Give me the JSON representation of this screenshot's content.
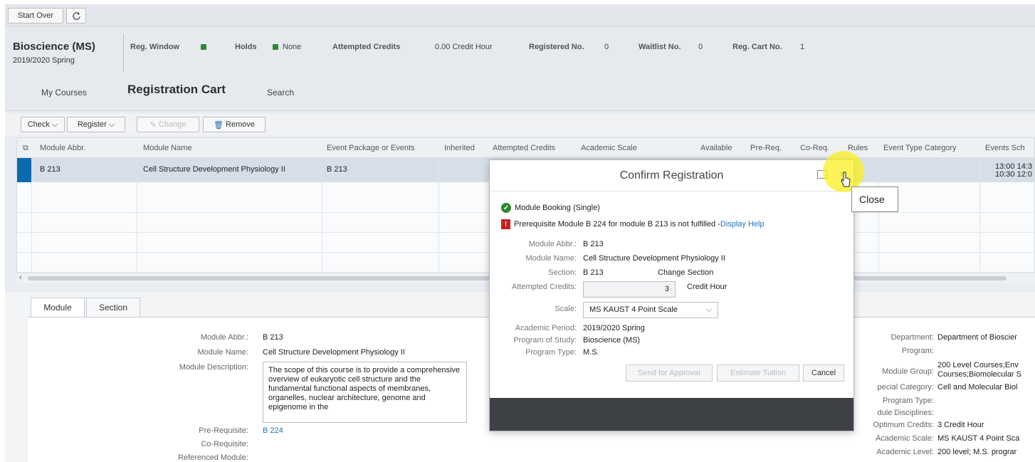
{
  "topbar": {
    "start_over": "Start Over",
    "refresh_icon": "refresh-icon"
  },
  "header": {
    "program": "Bioscience (MS)",
    "term": "2019/2020 Spring",
    "reg_window_label": "Reg. Window",
    "holds_label": "Holds",
    "holds_value": "None",
    "attempted_credits_label": "Attempted Credits",
    "attempted_credits_value": "0.00 Credit Hour",
    "registered_label": "Registered No.",
    "registered_value": "0",
    "waitlist_label": "Waitlist No.",
    "waitlist_value": "0",
    "cart_label": "Reg. Cart No.",
    "cart_value": "1",
    "status_color": "#2b8a2b"
  },
  "tabs": {
    "my_courses": "My Courses",
    "registration_cart": "Registration Cart",
    "search": "Search"
  },
  "toolbar": {
    "check": "Check",
    "register": "Register",
    "change": "Change",
    "remove": "Remove"
  },
  "grid": {
    "headers": [
      "Module Abbr.",
      "Module Name",
      "Event Package or Events",
      "Inherited",
      "Attempted Credits",
      "Academic Scale",
      "Available",
      "Pre-Req.",
      "Co-Req.",
      "Rules",
      "Event Type Category",
      "Events Sch"
    ],
    "row": {
      "abbr": "B 213",
      "name": "Cell Structure Development Physiology II",
      "events": "B 213",
      "sched1": "13:00 14:3",
      "sched2": "10:30 12:0"
    }
  },
  "lower": {
    "tab_module": "Module",
    "tab_section": "Section",
    "module_abbr_label": "Module Abbr.:",
    "module_abbr": "B 213",
    "module_name_label": "Module Name:",
    "module_name": "Cell Structure Development Physiology II",
    "module_desc_label": "Module Description:",
    "module_desc": "The scope of this course is to provide a comprehensive overview of eukaryotic cell structure and the fundamental functional aspects of membranes, organelles, nuclear architecture, genome and epigenome in the",
    "prereq_label": "Pre-Requisite:",
    "prereq": "B 224",
    "coreq_label": "Co-Requisite:",
    "ref_label": "Referenced Module:",
    "dept_label": "Department:",
    "dept": "Department of Bioscier",
    "program_label": "Program:",
    "group_label": "Module Group:",
    "group1": "200 Level Courses;Env",
    "group2": "Courses;Biomolecular S",
    "special_label": "pecial Category:",
    "special": "Cell and Molecular Biol",
    "ptype_label": "Program Type:",
    "disc_label": "dule Disciplines:",
    "optimum_label": "Optimum Credits:",
    "optimum": "3 Credit Hour",
    "scale_label": "Academic Scale:",
    "scale": "MS KAUST 4 Point Sca",
    "level_label": "Academic Level:",
    "level": "200 level; M.S. prograr"
  },
  "dialog": {
    "title": "Confirm Registration",
    "msg_ok": "Module Booking (Single)",
    "msg_err": "Prerequisite Module B 224 for module B 213 is not fulfilled - ",
    "msg_err_link": "Display Help",
    "abbr_label": "Module Abbr.:",
    "abbr": "B 213",
    "name_label": "Module Name:",
    "name": "Cell Structure Development Physiology II",
    "section_label": "Section:",
    "section": "B 213",
    "change_section": "Change Section",
    "credits_label": "Attempted Credits:",
    "credits": "3",
    "credit_unit": "Credit Hour",
    "scale_label": "Scale:",
    "scale": "MS KAUST 4 Point Scale",
    "period_label": "Academic Period:",
    "period": "2019/2020 Spring",
    "study_label": "Program of Study:",
    "study": "Bioscience (MS)",
    "ptype_label": "Program Type:",
    "ptype": "M.S.",
    "send_approve": "Send for Approval",
    "estimate": "Estimate Tuition",
    "cancel": "Cancel"
  },
  "tooltip": {
    "close": "Close"
  }
}
